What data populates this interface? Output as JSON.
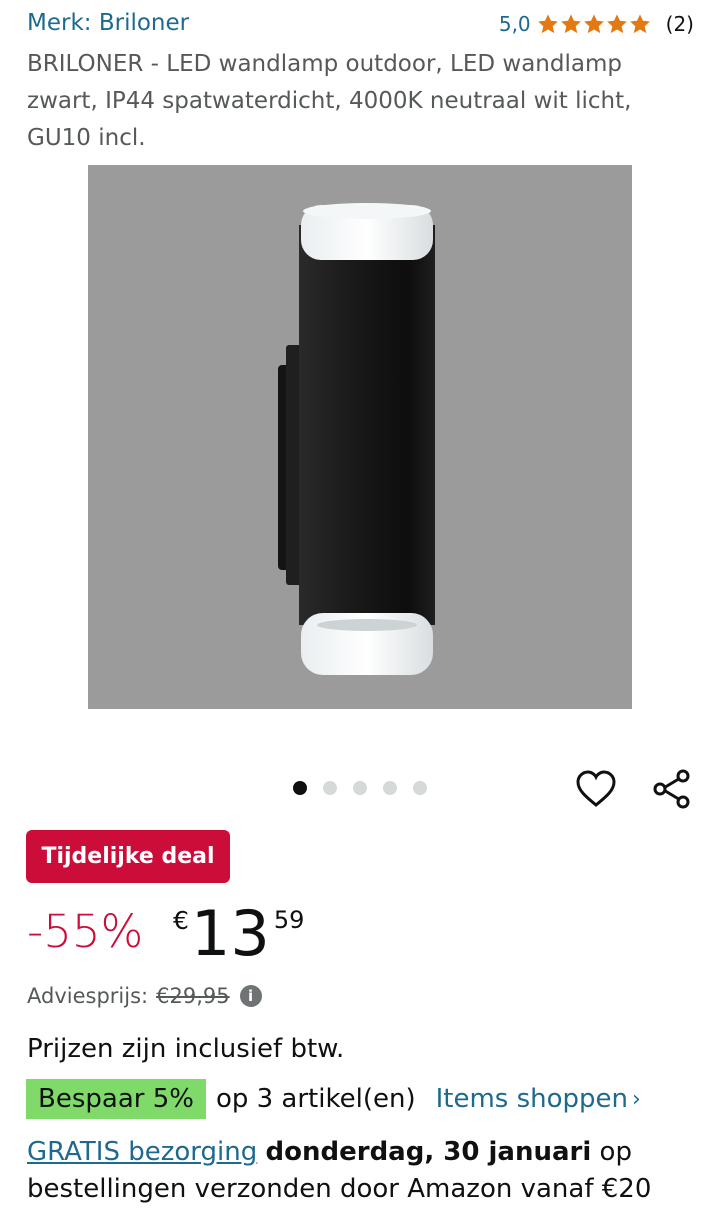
{
  "brand_label": "Merk: Briloner",
  "rating": {
    "value": "5,0",
    "stars": 5,
    "count": "(2)",
    "star_color": "#e47911"
  },
  "title": "BRILONER - LED wandlamp outdoor, LED wandlamp zwart, IP44 spatwaterdicht, 4000K neutraal wit licht, GU10 incl.",
  "carousel": {
    "total": 5,
    "active": 1
  },
  "icons": {
    "favorite": "heart-icon",
    "share": "share-icon",
    "info": "info-icon"
  },
  "deal": {
    "label": "Tijdelijke deal",
    "color": "#cc0c39"
  },
  "price": {
    "discount": "-55%",
    "currency": "€",
    "whole": "13",
    "fraction": "59",
    "list_label": "Adviesprijs:",
    "list_value": "€29,95",
    "info_glyph": "i"
  },
  "vat_note": "Prijzen zijn inclusief btw.",
  "save": {
    "badge": "Bespaar 5%",
    "text": "op 3 artikel(en)",
    "link": "Items shoppen",
    "chevron": "›",
    "badge_color": "#7fda69"
  },
  "delivery": {
    "link": "GRATIS bezorging",
    "date": "donderdag, 30 januari",
    "rest": "op bestellingen verzonden door Amazon vanaf €20"
  }
}
